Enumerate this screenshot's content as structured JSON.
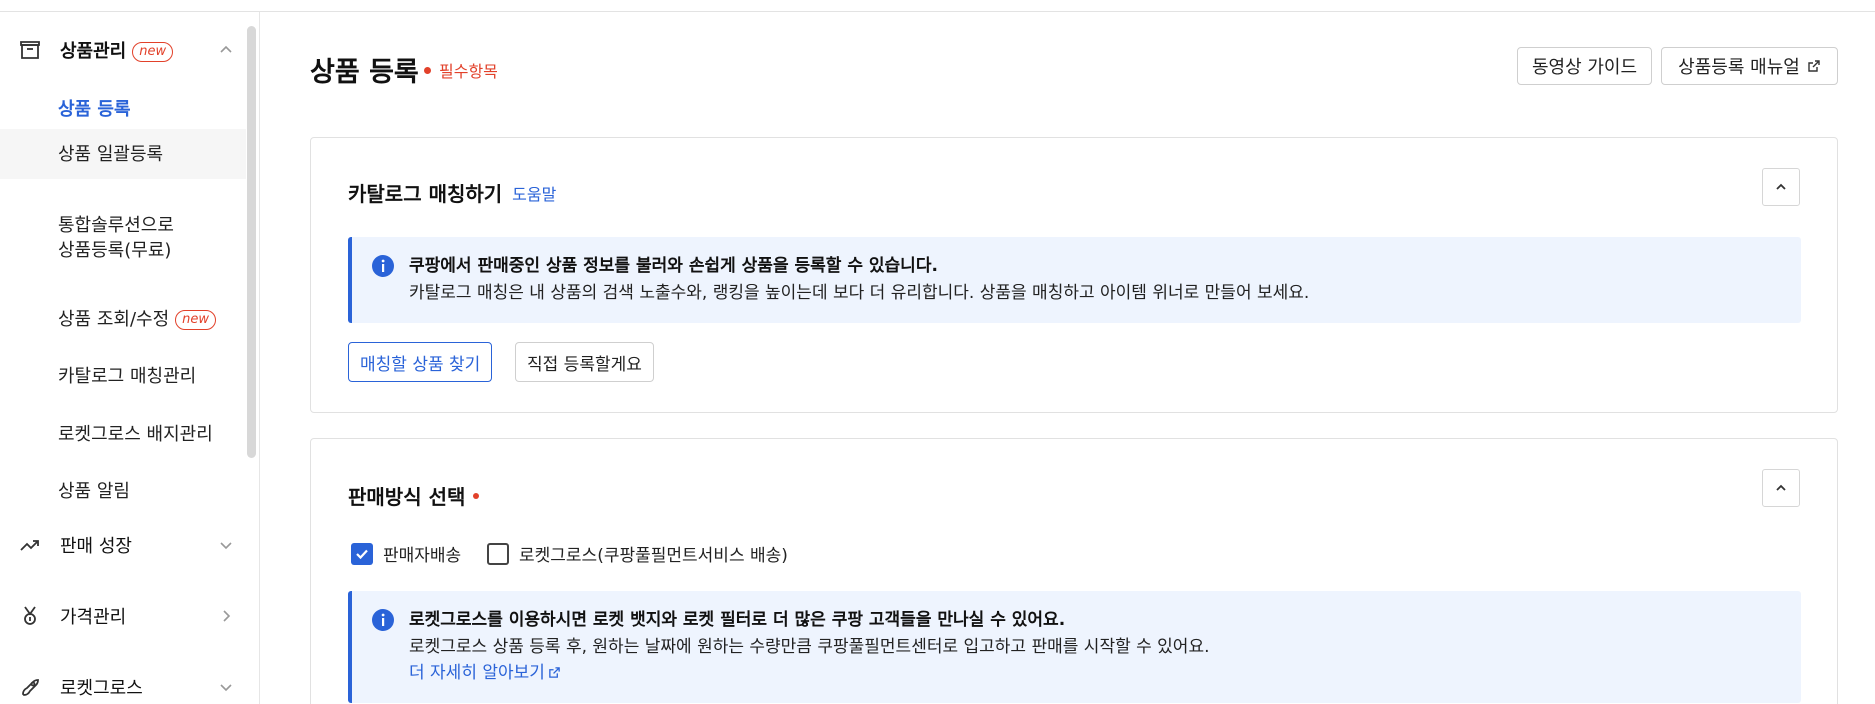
{
  "sidebar": {
    "product_mgmt": {
      "label": "상품관리",
      "badge": "new",
      "icon": "box-icon"
    },
    "items": [
      {
        "label": "상품 등록",
        "active": true
      },
      {
        "label": "상품 일괄등록"
      },
      {
        "label_line1": "통합솔루션으로",
        "label_line2": "상품등록(무료)"
      },
      {
        "label": "상품 조회/수정",
        "badge": "new"
      },
      {
        "label": "카탈로그 매칭관리"
      },
      {
        "label": "로켓그로스 배지관리"
      },
      {
        "label": "상품 알림"
      }
    ],
    "sales_growth": {
      "label": "판매 성장",
      "icon": "trend-up-icon"
    },
    "price_mgmt": {
      "label": "가격관리",
      "icon": "medal-icon"
    },
    "rocket_growth": {
      "label": "로켓그로스",
      "icon": "rocket-icon"
    }
  },
  "header": {
    "title": "상품 등록",
    "required_note": "필수항목",
    "video_guide": "동영상 가이드",
    "manual": "상품등록 매뉴얼"
  },
  "catalog": {
    "title": "카탈로그 매칭하기",
    "help": "도움말",
    "info_bold": "쿠팡에서 판매중인 상품 정보를 불러와 손쉽게 상품을 등록할 수 있습니다.",
    "info_text": "카탈로그 매칭은 내 상품의 검색 노출수와, 랭킹을 높이는데 보다 더 유리합니다. 상품을 매칭하고 아이템 위너로 만들어 보세요.",
    "find_button": "매칭할 상품 찾기",
    "direct_button": "직접 등록할게요"
  },
  "sales_method": {
    "title": "판매방식 선택",
    "option_seller": "판매자배송",
    "option_rocket": "로켓그로스(쿠팡풀필먼트서비스 배송)",
    "seller_checked": true,
    "rocket_checked": false,
    "info_bold": "로켓그로스를 이용하시면 로켓 뱃지와 로켓 필터로 더 많은 쿠팡 고객들을 만나실 수 있어요.",
    "info_text": "로켓그로스 상품 등록 후, 원하는 날짜에 원하는 수량만큼 쿠팡풀필먼트센터로 입고하고 판매를 시작할 수 있어요.",
    "learn_more": "더 자세히 알아보기"
  },
  "colors": {
    "accent": "#2a63d8",
    "required": "#e2412a",
    "info_bg": "#eef4fe"
  }
}
